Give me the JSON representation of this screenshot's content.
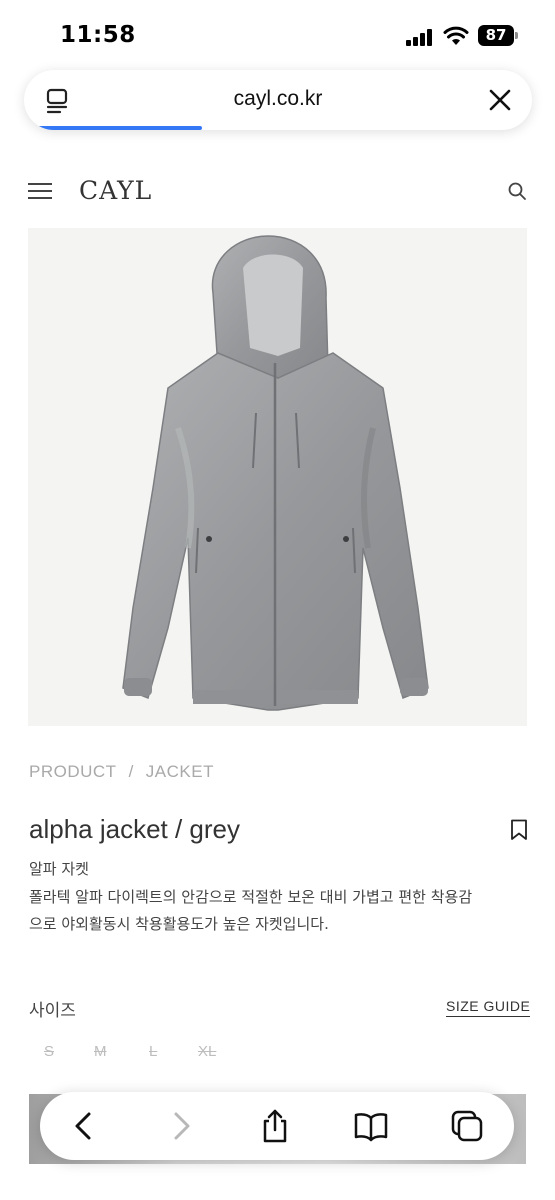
{
  "status_bar": {
    "time": "11:58",
    "battery": "87"
  },
  "address_bar": {
    "url": "cayl.co.kr",
    "load_progress": 0.35
  },
  "site_header": {
    "logo": "CAYL",
    "icons": [
      "menu-icon",
      "search-icon"
    ]
  },
  "product": {
    "image_alt": "grey hooded jacket",
    "breadcrumb": [
      "PRODUCT",
      "JACKET"
    ],
    "breadcrumb_separator": "/",
    "title": "alpha jacket / grey",
    "subtitle": "알파 자켓",
    "description_line1": "폴라텍 알파 다이렉트의 안감으로 적절한 보온 대비 가볍고 편한 착용감",
    "description_line2": "으로 야외활동시 착용활용도가 높은 자켓입니다.",
    "size_label": "사이즈",
    "size_guide": "SIZE GUIDE",
    "sizes": [
      {
        "label": "S",
        "available": false
      },
      {
        "label": "M",
        "available": false
      },
      {
        "label": "L",
        "available": false
      },
      {
        "label": "XL",
        "available": false
      }
    ]
  },
  "toolbar": {
    "icons": [
      "back-icon",
      "forward-icon",
      "share-icon",
      "bookmarks-icon",
      "tabs-icon"
    ]
  },
  "colors": {
    "accent": "#3478f6",
    "text": "#333333",
    "muted": "#a9a9a9",
    "jacket": "#9a9c9e"
  }
}
